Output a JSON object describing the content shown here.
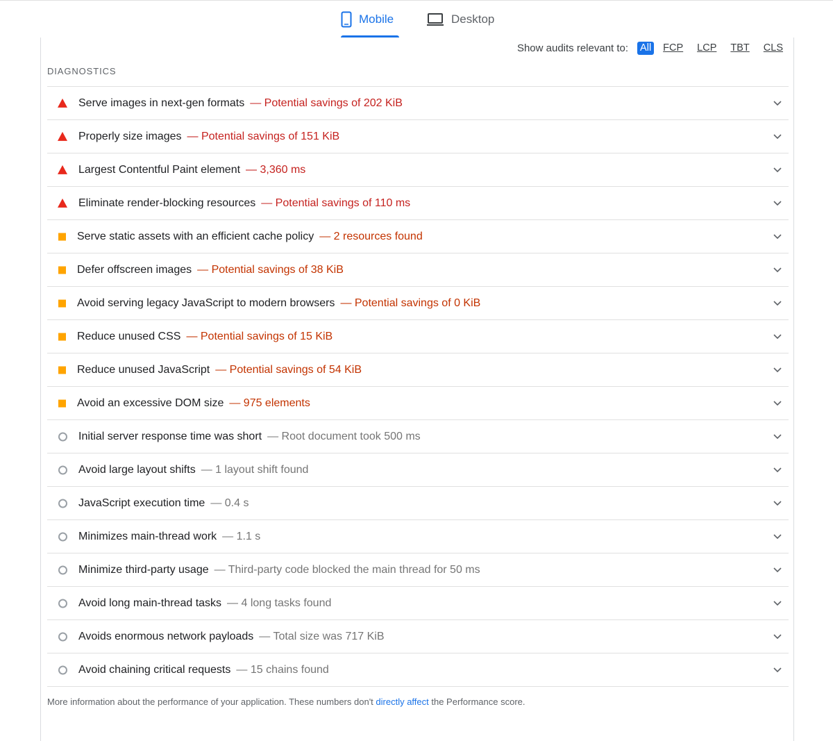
{
  "tabs": [
    {
      "label": "Mobile",
      "icon": "phone-icon",
      "active": true,
      "color": "#1a73e8"
    },
    {
      "label": "Desktop",
      "icon": "laptop-icon",
      "active": false,
      "color": "#5f6368"
    }
  ],
  "filter": {
    "label": "Show audits relevant to:",
    "options": [
      {
        "label": "All",
        "active": true
      },
      {
        "label": "FCP",
        "active": false
      },
      {
        "label": "LCP",
        "active": false
      },
      {
        "label": "TBT",
        "active": false
      },
      {
        "label": "CLS",
        "active": false
      }
    ]
  },
  "section_title": "DIAGNOSTICS",
  "colors": {
    "fail": "#e8291c",
    "fail_text": "#c5221f",
    "average": "#ffa400",
    "average_text": "#c33300",
    "info": "#9aa0a6",
    "info_text": "#757575",
    "accent": "#1a73e8"
  },
  "audits": [
    {
      "status": "fail",
      "title": "Serve images in next-gen formats",
      "display": "— Potential savings of 202 KiB"
    },
    {
      "status": "fail",
      "title": "Properly size images",
      "display": "— Potential savings of 151 KiB"
    },
    {
      "status": "fail",
      "title": "Largest Contentful Paint element",
      "display": "— 3,360 ms"
    },
    {
      "status": "fail",
      "title": "Eliminate render-blocking resources",
      "display": "— Potential savings of 110 ms"
    },
    {
      "status": "average",
      "title": "Serve static assets with an efficient cache policy",
      "display": "— 2 resources found"
    },
    {
      "status": "average",
      "title": "Defer offscreen images",
      "display": "— Potential savings of 38 KiB"
    },
    {
      "status": "average",
      "title": "Avoid serving legacy JavaScript to modern browsers",
      "display": "— Potential savings of 0 KiB"
    },
    {
      "status": "average",
      "title": "Reduce unused CSS",
      "display": "— Potential savings of 15 KiB"
    },
    {
      "status": "average",
      "title": "Reduce unused JavaScript",
      "display": "— Potential savings of 54 KiB"
    },
    {
      "status": "average",
      "title": "Avoid an excessive DOM size",
      "display": "— 975 elements"
    },
    {
      "status": "info",
      "title": "Initial server response time was short",
      "display": "— Root document took 500 ms"
    },
    {
      "status": "info",
      "title": "Avoid large layout shifts",
      "display": "— 1 layout shift found"
    },
    {
      "status": "info",
      "title": "JavaScript execution time",
      "display": "— 0.4 s"
    },
    {
      "status": "info",
      "title": "Minimizes main-thread work",
      "display": "— 1.1 s"
    },
    {
      "status": "info",
      "title": "Minimize third-party usage",
      "display": "— Third-party code blocked the main thread for 50 ms"
    },
    {
      "status": "info",
      "title": "Avoid long main-thread tasks",
      "display": "— 4 long tasks found"
    },
    {
      "status": "info",
      "title": "Avoids enormous network payloads",
      "display": "— Total size was 717 KiB"
    },
    {
      "status": "info",
      "title": "Avoid chaining critical requests",
      "display": "— 15 chains found"
    }
  ],
  "footer": {
    "before": "More information about the performance of your application. These numbers don't ",
    "link": "directly affect",
    "after": " the Performance score."
  }
}
